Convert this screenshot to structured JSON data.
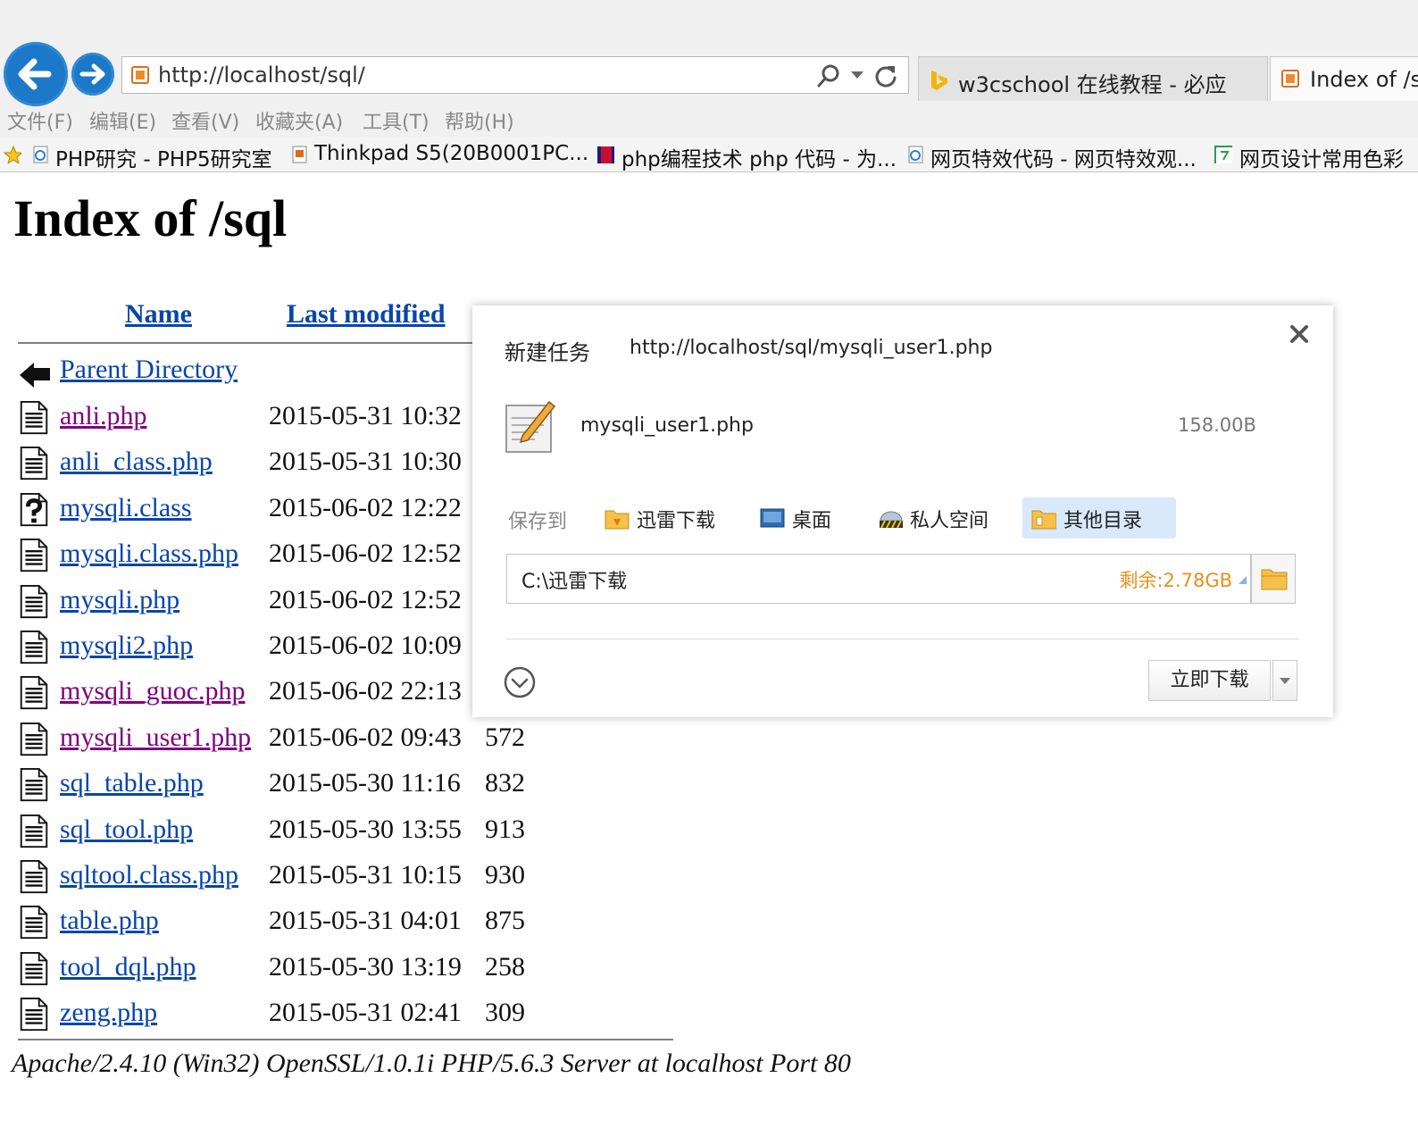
{
  "browser": {
    "address": "http://localhost/sql/",
    "tabs": [
      {
        "label": "w3cschool 在线教程 - 必应",
        "icon": "bing-icon"
      },
      {
        "label": "Index of /sql",
        "icon": "xampp-icon"
      }
    ],
    "menu": [
      "文件(F)",
      "编辑(E)",
      "查看(V)",
      "收藏夹(A)",
      "工具(T)",
      "帮助(H)"
    ],
    "favorites": [
      {
        "label": "PHP研究 - PHP5研究室",
        "icon": "ie-page-icon"
      },
      {
        "label": "Thinkpad S5(20B0001PC...",
        "icon": "page-icon"
      },
      {
        "label": "php编程技术 php 代码 - 为...",
        "icon": "film-icon"
      },
      {
        "label": "网页特效代码 - 网页特效观...",
        "icon": "ie-page-icon"
      },
      {
        "label": "网页设计常用色彩",
        "icon": "green-page-icon"
      }
    ]
  },
  "page": {
    "title": "Index of /sql",
    "columns": {
      "name": "Name",
      "modified": "Last modified"
    },
    "parent": "Parent Directory",
    "files": [
      {
        "name": "anli.php",
        "modified": "2015-05-31 10:32",
        "size": "",
        "icon": "text",
        "visited": true
      },
      {
        "name": "anli_class.php",
        "modified": "2015-05-31 10:30",
        "size": "",
        "icon": "text",
        "visited": false
      },
      {
        "name": "mysqli.class",
        "modified": "2015-06-02 12:22",
        "size": "",
        "icon": "unknown",
        "visited": false
      },
      {
        "name": "mysqli.class.php",
        "modified": "2015-06-02 12:52",
        "size": "",
        "icon": "text",
        "visited": false
      },
      {
        "name": "mysqli.php",
        "modified": "2015-06-02 12:52",
        "size": "",
        "icon": "text",
        "visited": false
      },
      {
        "name": "mysqli2.php",
        "modified": "2015-06-02 10:09",
        "size": "",
        "icon": "text",
        "visited": false
      },
      {
        "name": "mysqli_guoc.php",
        "modified": "2015-06-02 22:13",
        "size": "",
        "icon": "text",
        "visited": true
      },
      {
        "name": "mysqli_user1.php",
        "modified": "2015-06-02 09:43",
        "size": "572",
        "icon": "text",
        "visited": true
      },
      {
        "name": "sql_table.php",
        "modified": "2015-05-30 11:16",
        "size": "832",
        "icon": "text",
        "visited": false
      },
      {
        "name": "sql_tool.php",
        "modified": "2015-05-30 13:55",
        "size": "913",
        "icon": "text",
        "visited": false
      },
      {
        "name": "sqltool.class.php",
        "modified": "2015-05-31 10:15",
        "size": "930",
        "icon": "text",
        "visited": false
      },
      {
        "name": "table.php",
        "modified": "2015-05-31 04:01",
        "size": "875",
        "icon": "text",
        "visited": false
      },
      {
        "name": "tool_dql.php",
        "modified": "2015-05-30 13:19",
        "size": "258",
        "icon": "text",
        "visited": false
      },
      {
        "name": "zeng.php",
        "modified": "2015-05-31 02:41",
        "size": "309",
        "icon": "text",
        "visited": false
      }
    ],
    "footer": "Apache/2.4.10 (Win32) OpenSSL/1.0.1i PHP/5.6.3 Server at localhost Port 80"
  },
  "dialog": {
    "title": "新建任务",
    "url": "http://localhost/sql/mysqli_user1.php",
    "filename": "mysqli_user1.php",
    "filesize": "158.00B",
    "save_to_label": "保存到",
    "destinations": [
      {
        "label": "迅雷下载",
        "icon": "xunlei-folder-icon"
      },
      {
        "label": "桌面",
        "icon": "desktop-icon"
      },
      {
        "label": "私人空间",
        "icon": "private-space-icon"
      },
      {
        "label": "其他目录",
        "icon": "folder-icon",
        "selected": true
      }
    ],
    "path": "C:\\迅雷下载",
    "free_space": "剩余:2.78GB",
    "download_label": "立即下载",
    "colors": {
      "free_space": "#e8901a",
      "selected_dest": "#d9e8fb",
      "link": "#0645ad",
      "visited": "#800080"
    }
  }
}
